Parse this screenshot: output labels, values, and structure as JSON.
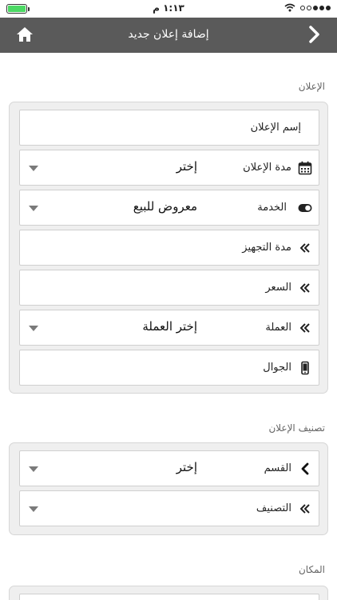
{
  "status_bar": {
    "time": "١:١٣ م"
  },
  "header": {
    "title": "إضافة إعلان جديد",
    "home_icon": "home-icon",
    "back_icon": "chevron-right-icon"
  },
  "sections": {
    "ad": {
      "label": "الإعلان",
      "rows": {
        "name": {
          "placeholder": "إسم الإعلان"
        },
        "duration": {
          "label": "مدة الإعلان",
          "value": "إختر",
          "icon": "calendar-icon"
        },
        "service": {
          "label": "الخدمة",
          "value": "معروض للبيع",
          "icon": "toggle-icon"
        },
        "prep": {
          "label": "مدة التجهيز",
          "icon": "double-chevron-icon"
        },
        "price": {
          "label": "السعر",
          "icon": "double-chevron-icon"
        },
        "currency": {
          "label": "العملة",
          "value": "إختر العملة",
          "icon": "double-chevron-icon"
        },
        "mobile": {
          "label": "الجوال",
          "icon": "phone-icon"
        }
      }
    },
    "classification": {
      "label": "تصنيف الإعلان",
      "rows": {
        "category": {
          "label": "القسم",
          "value": "إختر",
          "icon": "chevron-left-icon"
        },
        "subcategory": {
          "label": "التصنيف",
          "icon": "double-chevron-icon"
        }
      }
    },
    "location": {
      "label": "المكان"
    }
  }
}
